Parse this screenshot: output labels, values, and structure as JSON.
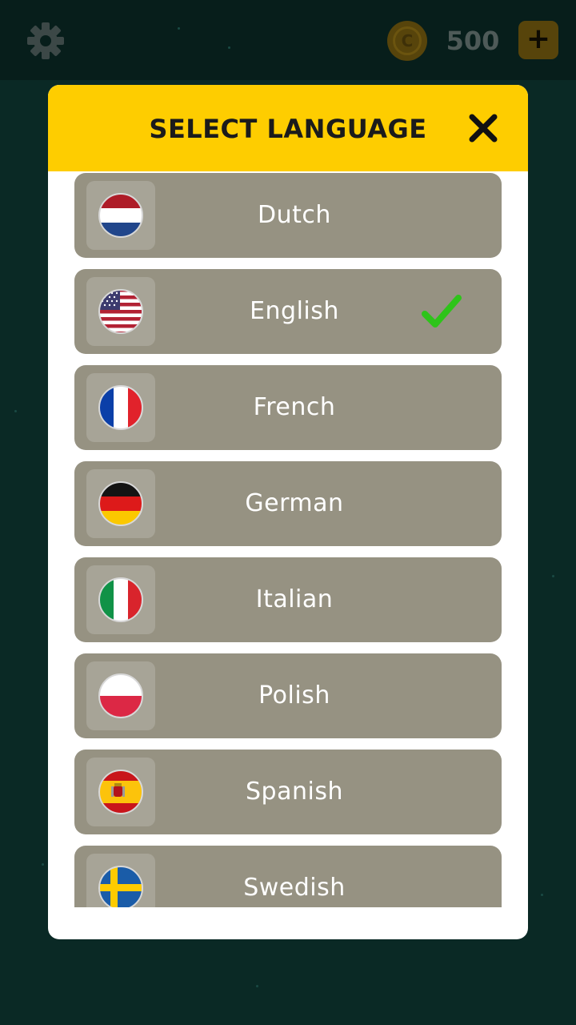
{
  "topbar": {
    "gear_icon": "gear-icon",
    "coin_symbol": "C",
    "coin_count": "500",
    "plus_label": "+"
  },
  "modal": {
    "title": "SELECT LANGUAGE",
    "close_icon": "close-icon"
  },
  "languages": [
    {
      "label": "Dutch",
      "flag": "nl",
      "selected": false
    },
    {
      "label": "English",
      "flag": "us",
      "selected": true
    },
    {
      "label": "French",
      "flag": "fr",
      "selected": false
    },
    {
      "label": "German",
      "flag": "de",
      "selected": false
    },
    {
      "label": "Italian",
      "flag": "it",
      "selected": false
    },
    {
      "label": "Polish",
      "flag": "pl",
      "selected": false
    },
    {
      "label": "Spanish",
      "flag": "es",
      "selected": false
    },
    {
      "label": "Swedish",
      "flag": "se",
      "selected": false
    }
  ],
  "colors": {
    "background": "#0a2925",
    "header": "#fecd00",
    "item": "#969282",
    "check": "#2ec41a"
  }
}
